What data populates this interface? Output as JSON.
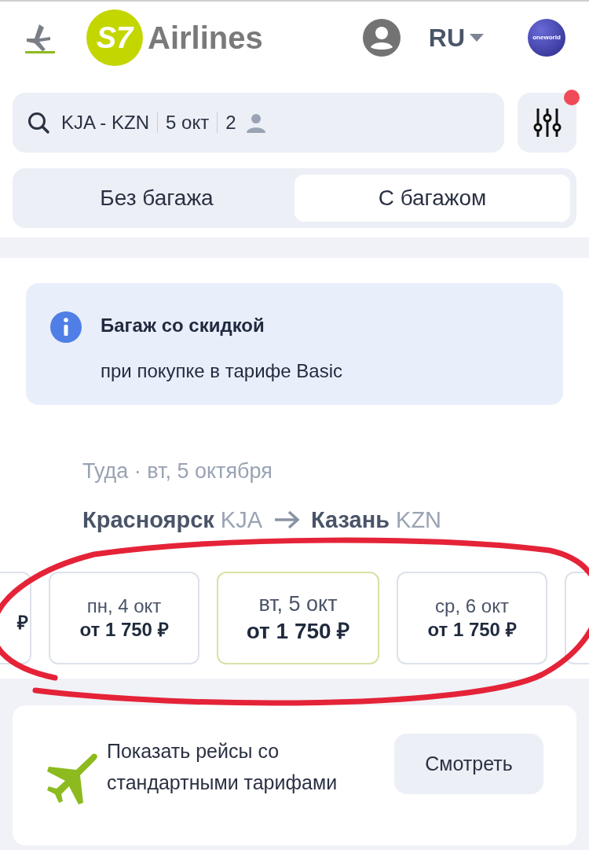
{
  "header": {
    "logo_mark": "S7",
    "logo_text": "Airlines",
    "language": "RU",
    "alliance_logo": "oneworld"
  },
  "search": {
    "route": "KJA - KZN",
    "date": "5 окт",
    "passengers": "2",
    "filter_badge": true
  },
  "tabs": [
    {
      "label": "Без багажа",
      "selected": false
    },
    {
      "label": "С багажом",
      "selected": true
    }
  ],
  "notice": {
    "title": "Багаж со скидкой",
    "text": "при покупке в тарифе Basic"
  },
  "direction": {
    "label": "Туда · вт, 5 октября",
    "from_city": "Красноярск",
    "from_code": "KJA",
    "to_city": "Казань",
    "to_code": "KZN"
  },
  "dates": [
    {
      "kind": "clipped_left",
      "price": "₽",
      "selected": false
    },
    {
      "kind": "full",
      "day": "пн, 4 окт",
      "price": "от 1 750 ₽",
      "selected": false
    },
    {
      "kind": "full",
      "day": "вт, 5 окт",
      "price": "от 1 750 ₽",
      "selected": true
    },
    {
      "kind": "full",
      "day": "ср, 6 окт",
      "price": "от 1 750 ₽",
      "selected": false
    },
    {
      "kind": "clipped_right",
      "selected": false
    }
  ],
  "promo": {
    "text": "Показать рейсы со стандартными тарифами",
    "button": "Смотреть"
  }
}
